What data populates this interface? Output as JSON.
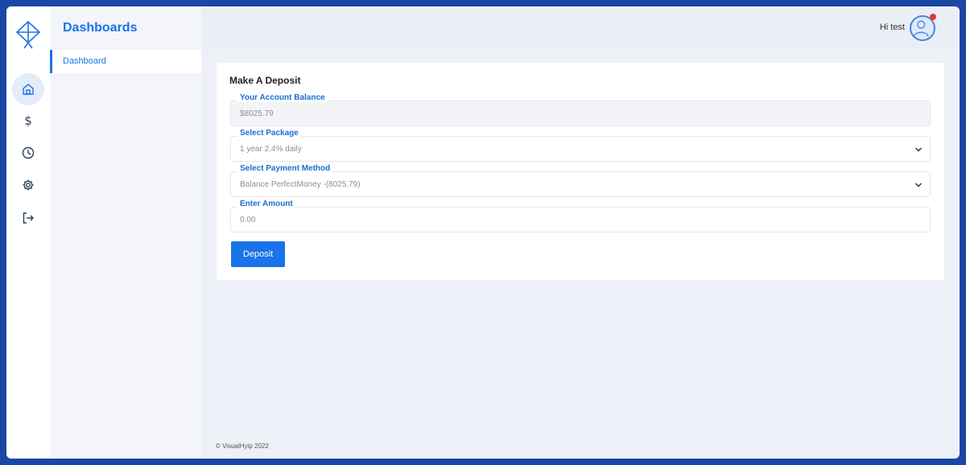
{
  "sidebar": {
    "icons": [
      "kite-logo-icon",
      "home-icon",
      "dollar-icon",
      "clock-icon",
      "gear-icon",
      "logout-icon"
    ],
    "dollar_glyph": "$"
  },
  "subnav": {
    "title": "Dashboards",
    "items": [
      {
        "label": "Dashboard"
      }
    ]
  },
  "header": {
    "greeting": "Hi test"
  },
  "form": {
    "title": "Make A Deposit",
    "fields": [
      {
        "label": "Your Account Balance",
        "value": "$8025.79"
      },
      {
        "label": "Select Package",
        "value": "1 year 2.4% daily"
      },
      {
        "label": "Select Payment Method",
        "value": "Balance PerfectMoney -(8025.79)"
      },
      {
        "label": "Enter Amount",
        "value": "0.00"
      }
    ],
    "submit_label": "Deposit"
  },
  "footer": {
    "text": "© VisualHyip 2022"
  },
  "colors": {
    "accent": "#1a73e8",
    "frame": "#1a47a6",
    "notification": "#e53935"
  }
}
